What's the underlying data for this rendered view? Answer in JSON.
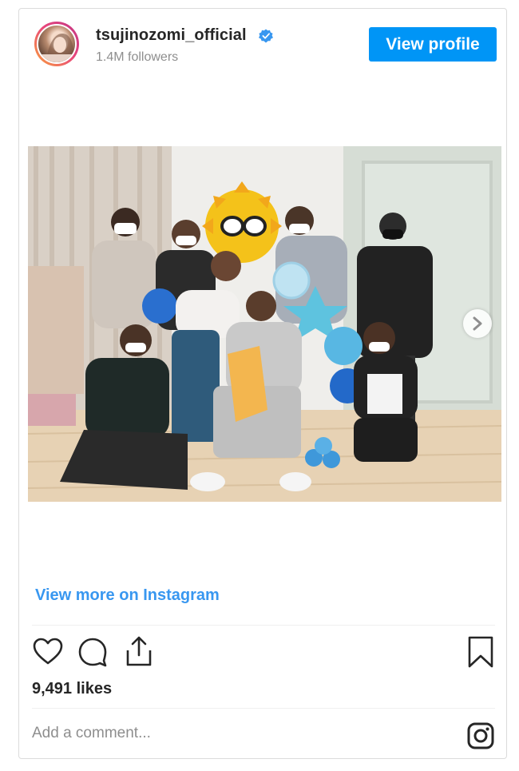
{
  "header": {
    "username": "tsujinozomi_official",
    "verified_icon": "verified-badge-icon",
    "followers": "1.4M followers",
    "view_profile_label": "View profile"
  },
  "post": {
    "image_alt": "Group photo of eight people with balloons and a sun decoration",
    "next_icon": "chevron-right-icon"
  },
  "footer": {
    "view_more_label": "View more on Instagram",
    "likes": "9,491 likes",
    "comment_placeholder": "Add a comment...",
    "action_icons": [
      "heart-icon",
      "comment-icon",
      "share-icon",
      "bookmark-icon",
      "instagram-icon"
    ]
  },
  "colors": {
    "accent": "#0095f6",
    "link": "#3897f0",
    "muted": "#8e8e8e",
    "text": "#262626",
    "border": "#dbdbdb"
  }
}
